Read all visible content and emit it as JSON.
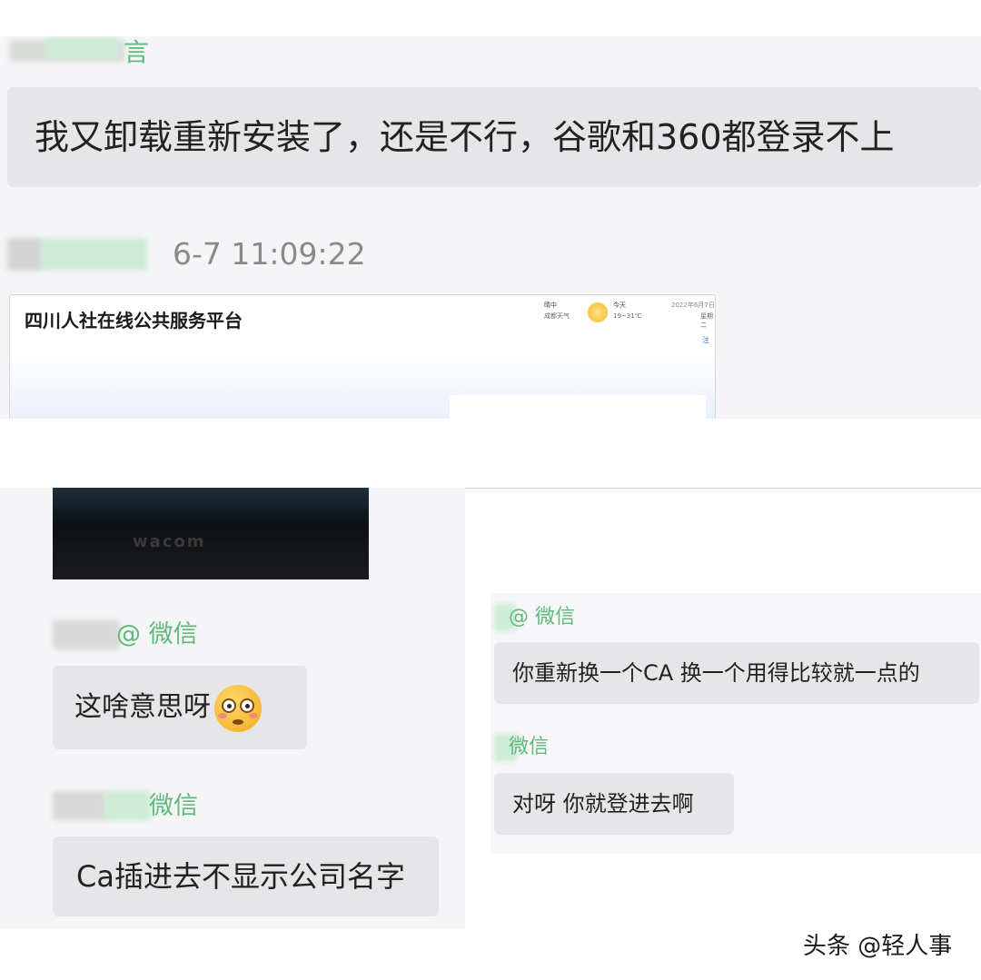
{
  "top": {
    "sender_tag": "言",
    "message_1": "我又卸载重新安装了，还是不行，谷歌和360都登录不上",
    "timestamp": "6-7 11:09:22",
    "screenshot": {
      "site_title": "四川人社在线公共服务平台",
      "weather_condition": "晴中",
      "weather_city": "成都天气",
      "weather_today": "今天",
      "weather_temp": "19~31℃",
      "date": "2022年6月7日",
      "more": "星期二",
      "link": "注"
    }
  },
  "left": {
    "photo_logo": "wacom",
    "sender_tag_1": "@ 微信",
    "message_2": "这啥意思呀",
    "emoji_name": "flushed-face-emoji",
    "sender_tag_2": "微信",
    "message_3": "Ca插进去不显示公司名字"
  },
  "right": {
    "sender_tag_1": "@ 微信",
    "message_4": "你重新换一个CA  换一个用得比较就一点的",
    "sender_tag_2": "微信",
    "message_5": "对呀  你就登进去啊"
  },
  "watermark": "头条 @轻人事",
  "colors": {
    "tag_green": "#5fb97a",
    "bubble_gray": "#e6e6e9",
    "panel_bg": "#f5f5f7"
  }
}
